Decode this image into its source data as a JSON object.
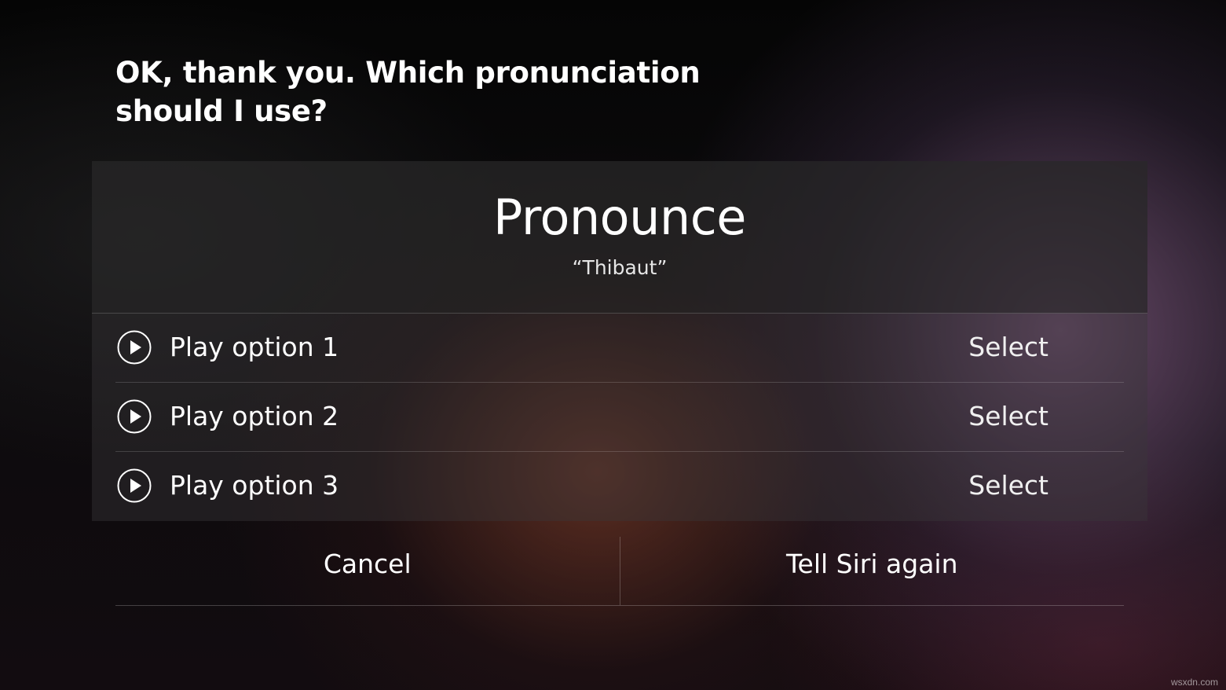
{
  "siri": {
    "prompt": "OK, thank you. Which pronunciation should I use?"
  },
  "card": {
    "title": "Pronounce",
    "subtitle": "“Thibaut”",
    "options": [
      {
        "label": "Play option 1",
        "select_label": "Select",
        "icon": "play-circle-icon"
      },
      {
        "label": "Play option 2",
        "select_label": "Select",
        "icon": "play-circle-icon"
      },
      {
        "label": "Play option 3",
        "select_label": "Select",
        "icon": "play-circle-icon"
      }
    ]
  },
  "actions": {
    "cancel_label": "Cancel",
    "retry_label": "Tell Siri again"
  },
  "watermark": "wsxdn.com"
}
